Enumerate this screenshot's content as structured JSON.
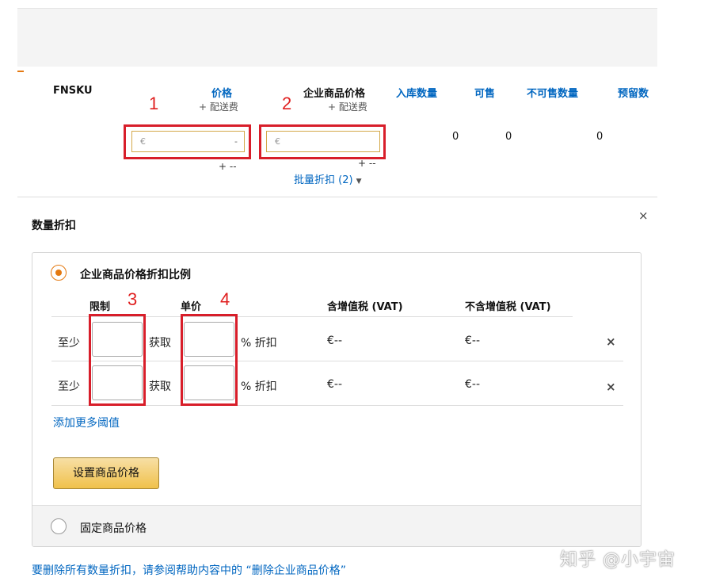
{
  "headers": {
    "fnsku": "FNSKU",
    "price": "价格",
    "price_sub": "+ 配送费",
    "business_price": "企业商品价格",
    "business_price_sub": "+ 配送费",
    "inbound": "入库数量",
    "sellable": "可售",
    "unsellable": "不可售数量",
    "reserved": "预留数"
  },
  "annotations": [
    "1",
    "2",
    "3",
    "4"
  ],
  "row": {
    "price_input_symbol": "€",
    "price_input_dash": "-",
    "business_input_symbol": "€",
    "price_shipping": "+ --",
    "business_shipping": "+ --",
    "inbound": "0",
    "sellable": "0",
    "unsellable": "0",
    "bulk_discount_link": "批量折扣 (2)"
  },
  "quantity_discount": {
    "title": "数量折扣",
    "close": "×",
    "option_percent": "企业商品价格折扣比例",
    "col_limit": "限制",
    "col_unit": "单价",
    "col_vat": "含增值税 (VAT)",
    "col_novat": "不含增值税 (VAT)",
    "rows": [
      {
        "at_least": "至少",
        "get": "获取",
        "pct": "% 折扣",
        "vat": "€--",
        "novat": "€--",
        "remove": "×"
      },
      {
        "at_least": "至少",
        "get": "获取",
        "pct": "% 折扣",
        "vat": "€--",
        "novat": "€--",
        "remove": "×"
      }
    ],
    "add_more": "添加更多阈值",
    "set_button": "设置商品价格",
    "option_fixed": "固定商品价格"
  },
  "footer_link": "要删除所有数量折扣，请参阅帮助内容中的 “删除企业商品价格”",
  "watermark": "知乎 @小宇宙",
  "colors": {
    "link": "#0066c0",
    "accent": "#e47911",
    "annotation_red": "#d81e2a",
    "button": "#f0c14b"
  }
}
